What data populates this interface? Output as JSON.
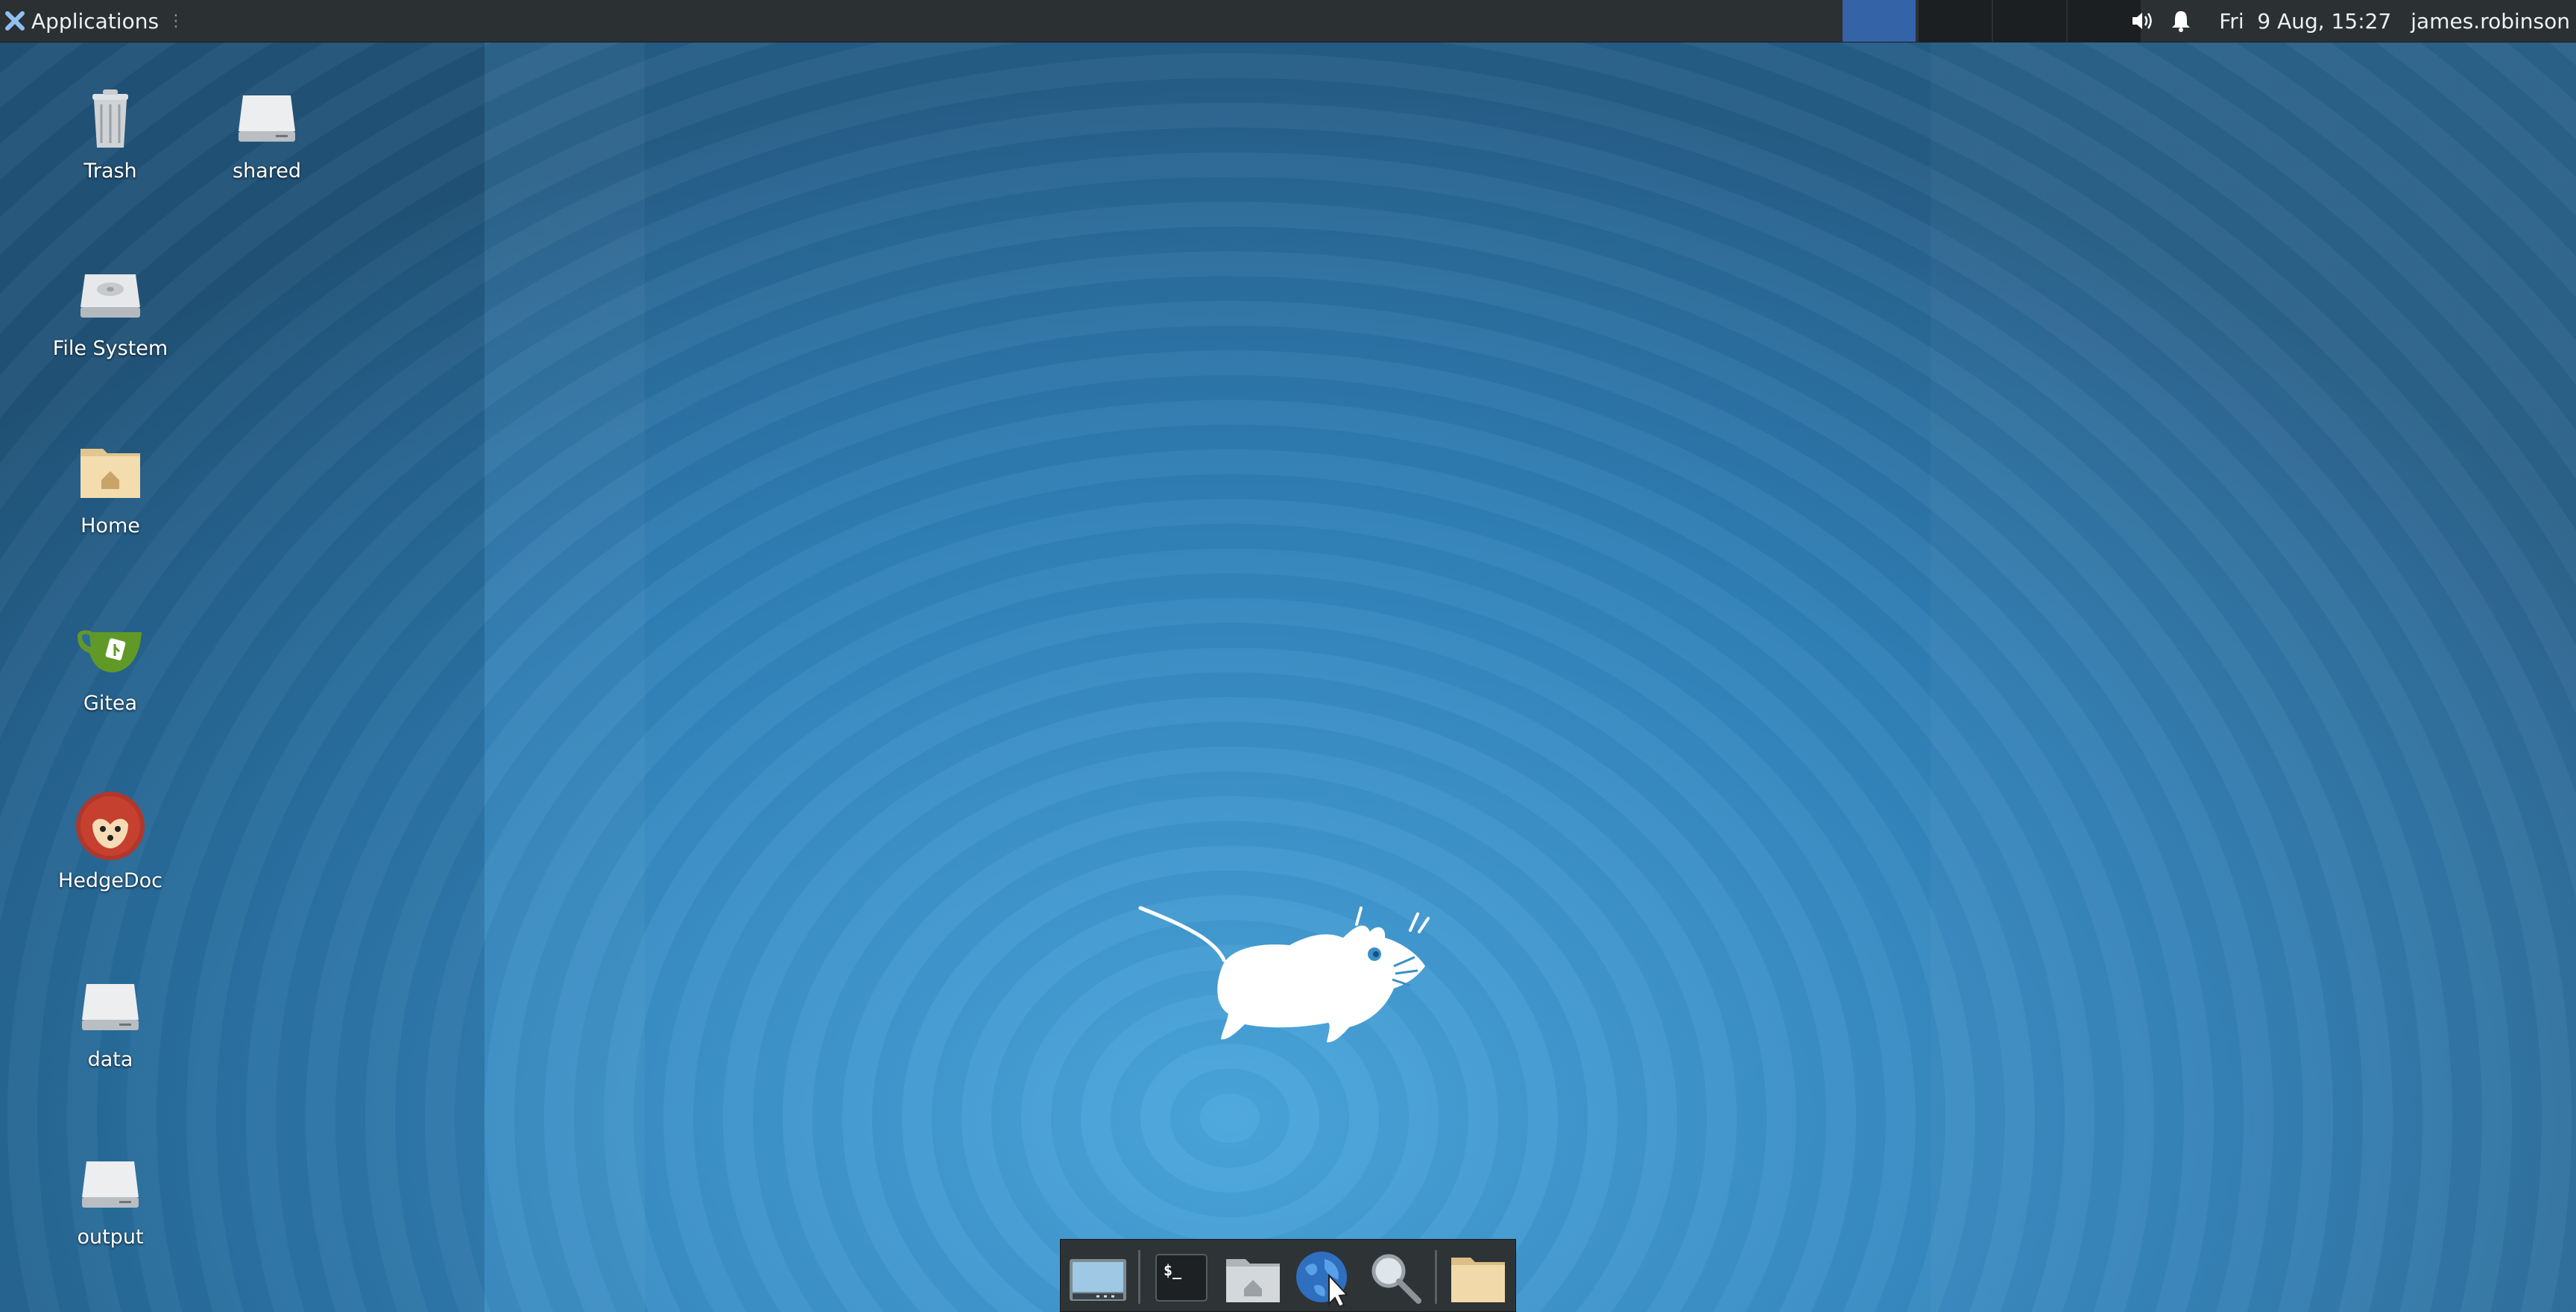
{
  "panel": {
    "applications_label": "Applications",
    "applications_icon": "xfce-icon",
    "workspaces": [
      {
        "name": "workspace-1",
        "active": true
      },
      {
        "name": "workspace-2",
        "active": false
      },
      {
        "name": "workspace-3",
        "active": false
      },
      {
        "name": "workspace-4",
        "active": false
      }
    ],
    "tray_icons": [
      "volume-icon",
      "notification-bell-icon"
    ],
    "clock": "Fri  9 Aug, 15:27",
    "user": "james.robinson"
  },
  "desktop": {
    "icons": [
      {
        "label": "Trash",
        "icon": "trash-icon"
      },
      {
        "label": "shared",
        "icon": "drive-icon"
      },
      {
        "label": "File System",
        "icon": "harddisk-icon"
      },
      {
        "label": "Home",
        "icon": "home-folder-icon"
      },
      {
        "label": "Gitea",
        "icon": "gitea-icon"
      },
      {
        "label": "HedgeDoc",
        "icon": "hedgedoc-icon"
      },
      {
        "label": "data",
        "icon": "drive-icon"
      },
      {
        "label": "output",
        "icon": "drive-icon"
      }
    ]
  },
  "dock": {
    "items": [
      "show-desktop-icon",
      "terminal-icon",
      "home-folder-icon",
      "web-browser-icon",
      "search-icon",
      "folder-icon"
    ]
  },
  "colors": {
    "panel_bg": "#2b3033",
    "active_workspace": "#3563a8",
    "desktop_accent": "#3a90c8"
  }
}
